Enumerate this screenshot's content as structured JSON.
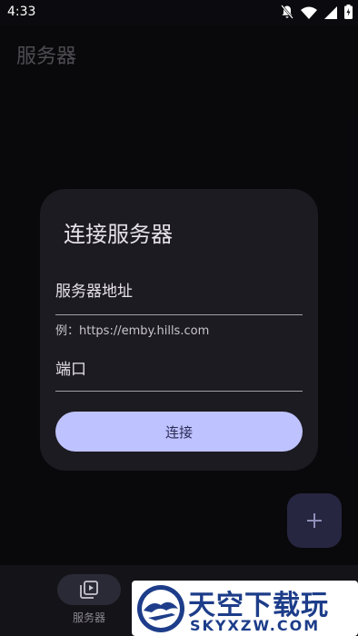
{
  "status_bar": {
    "time": "4:33"
  },
  "app_bar": {
    "title": "服务器"
  },
  "dialog": {
    "title": "连接服务器",
    "server_address_label": "服务器地址",
    "server_address_helper": "例：https://emby.hills.com",
    "port_label": "端口",
    "connect_label": "连接"
  },
  "bottom_nav": {
    "items": [
      {
        "label": "服务器",
        "icon": "server-media-icon"
      }
    ]
  },
  "watermark": {
    "title": "天空下载玩",
    "domain": "SKYXZW.COM"
  },
  "colors": {
    "accent": "#bec2ff",
    "dialog_bg": "#1c1b21",
    "background": "#0b0b0f",
    "fab_bg": "#262641"
  }
}
